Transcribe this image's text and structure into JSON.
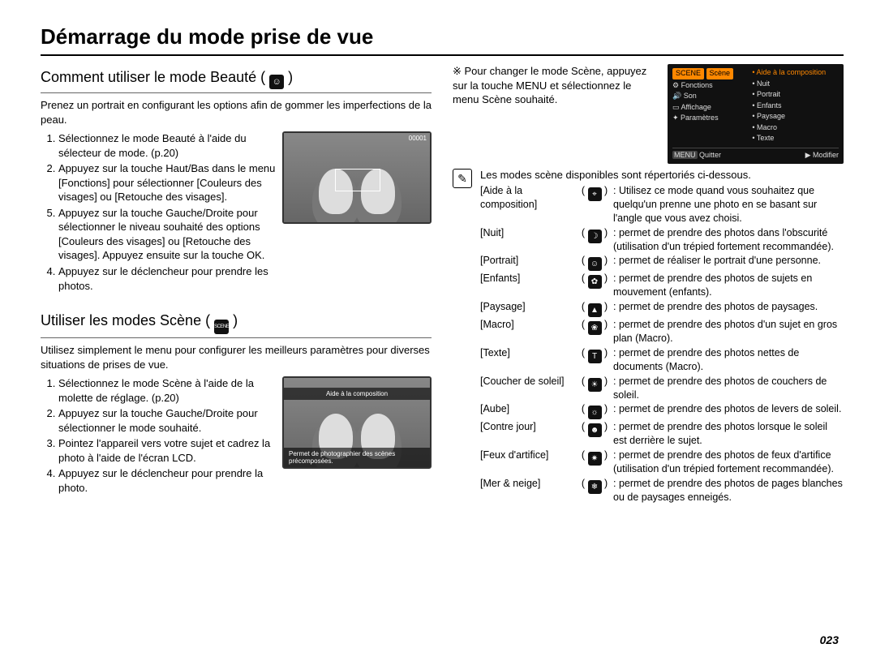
{
  "title": "Démarrage du mode prise de vue",
  "page_number": "023",
  "left": {
    "beauty": {
      "heading": "Comment utiliser le mode Beauté (",
      "icon_name": "beauty-icon",
      "heading_close": ")",
      "intro": "Prenez un portrait en configurant les options afin de gommer les imperfections de la peau.",
      "steps": [
        "Sélectionnez le mode Beauté à l'aide du sélecteur de mode. (p.20)",
        "Appuyez sur la touche Haut/Bas dans le menu [Fonctions] pour sélectionner [Couleurs des visages] ou [Retouche des visages].",
        "Appuyez sur la touche Gauche/Droite pour sélectionner le niveau souhaité des options [Couleurs des visages] ou [Retouche des visages]. Appuyez ensuite sur la touche OK.",
        "Appuyez sur le déclencheur pour prendre les photos."
      ],
      "step3_number": "5.",
      "shot_top": "00001"
    },
    "scene": {
      "heading": "Utiliser les modes Scène (",
      "icon_name": "scene-icon",
      "icon_label": "SCENE",
      "heading_close": ")",
      "intro": "Utilisez simplement le menu pour configurer les meilleurs paramètres pour diverses situations de prises de vue.",
      "steps": [
        "Sélectionnez le mode Scène à l'aide de la molette de réglage. (p.20)",
        "Appuyez sur la touche Gauche/Droite pour sélectionner le mode souhaité.",
        "Pointez l'appareil vers votre sujet et cadrez la photo à l'aide de l'écran LCD.",
        "Appuyez sur le déclencheur pour prendre la photo."
      ],
      "shot_band_top": "Aide à la composition",
      "shot_band_bot": "Permet de photographier des scènes précomposées."
    }
  },
  "right": {
    "change_note_prefix": "※ ",
    "change_note": "Pour changer le mode Scène, appuyez sur la touche MENU et sélectionnez le menu Scène souhaité.",
    "menu": {
      "left": [
        "Scène",
        "Fonctions",
        "Son",
        "Affichage",
        "Paramètres"
      ],
      "right": [
        "Aide à la composition",
        "Nuit",
        "Portrait",
        "Enfants",
        "Paysage",
        "Macro",
        "Texte"
      ],
      "footer_left": "Quitter",
      "footer_right": "Modifier",
      "badge_left": "SCENE",
      "badge_quit": "MENU"
    },
    "note_icon_glyph": "✎",
    "list_intro": "Les modes scène disponibles sont répertoriés ci-dessous.",
    "modes": [
      {
        "name": "[Aide à la composition]",
        "icon": "⌖",
        "desc": "Utilisez ce mode quand vous souhaitez que quelqu'un prenne une photo en se basant sur l'angle que vous avez choisi."
      },
      {
        "name": "[Nuit]",
        "icon": "☽",
        "desc": "permet de prendre des photos dans l'obscurité (utilisation d'un trépied fortement recommandée)."
      },
      {
        "name": "[Portrait]",
        "icon": "☺",
        "desc": "permet de réaliser le portrait d'une personne."
      },
      {
        "name": "[Enfants]",
        "icon": "✿",
        "desc": "permet de prendre des photos de sujets en mouvement (enfants)."
      },
      {
        "name": "[Paysage]",
        "icon": "▲",
        "desc": "permet de prendre des photos de paysages."
      },
      {
        "name": "[Macro]",
        "icon": "❀",
        "desc": "permet de prendre des photos d'un sujet en gros plan (Macro)."
      },
      {
        "name": "[Texte]",
        "icon": "T",
        "desc": "permet de prendre des photos nettes de documents (Macro)."
      },
      {
        "name": "[Coucher de soleil]",
        "icon": "☀",
        "desc": "permet de prendre des photos de couchers de soleil."
      },
      {
        "name": "[Aube]",
        "icon": "☼",
        "desc": "permet de prendre des photos de levers de soleil."
      },
      {
        "name": "[Contre jour]",
        "icon": "☻",
        "desc": "permet de prendre des photos lorsque le soleil est derrière le sujet."
      },
      {
        "name": "[Feux d'artifice]",
        "icon": "✷",
        "desc": "permet de prendre des photos de feux d'artifice (utilisation d'un trépied fortement recommandée)."
      },
      {
        "name": "[Mer & neige]",
        "icon": "❄",
        "desc": "permet de prendre des photos de pages blanches ou de paysages enneigés."
      }
    ]
  }
}
